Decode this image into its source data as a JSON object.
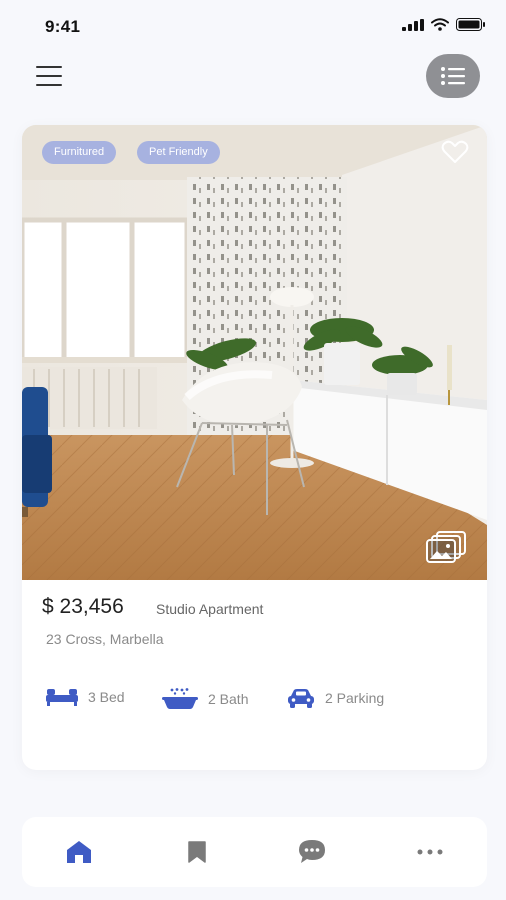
{
  "status_bar": {
    "time": "9:41"
  },
  "listing": {
    "tags": [
      "Furnitured",
      "Pet Friendly"
    ],
    "price": "$ 23,456",
    "type": "Studio Apartment",
    "address": "23 Cross, Marbella",
    "features": [
      {
        "icon": "bed-icon",
        "label": "3 Bed"
      },
      {
        "icon": "bathtub-icon",
        "label": "2 Bath"
      },
      {
        "icon": "car-icon",
        "label": "2 Parking"
      }
    ]
  },
  "nav": [
    "home-icon",
    "bookmark-icon",
    "chat-icon",
    "more-icon"
  ],
  "colors": {
    "accent": "#3f5bc4",
    "tag": "#a7b2e0",
    "background": "#f7f8fc",
    "nav_inactive": "#7a7a7a"
  }
}
